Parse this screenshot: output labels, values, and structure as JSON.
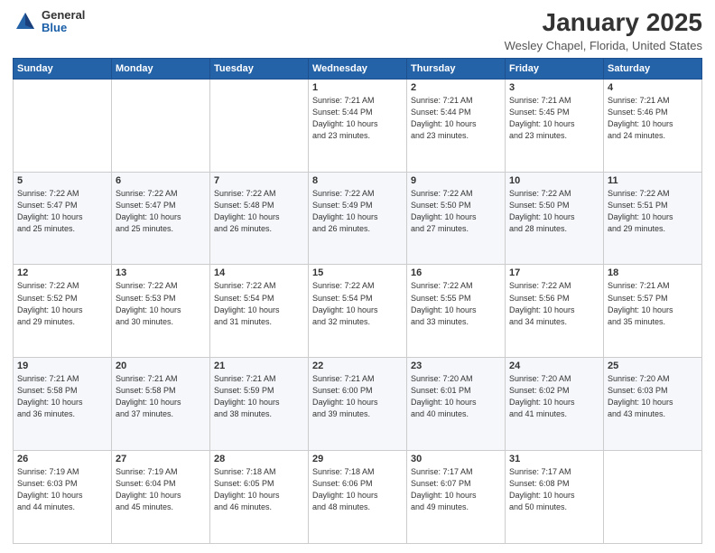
{
  "logo": {
    "general": "General",
    "blue": "Blue"
  },
  "title": "January 2025",
  "location": "Wesley Chapel, Florida, United States",
  "days_header": [
    "Sunday",
    "Monday",
    "Tuesday",
    "Wednesday",
    "Thursday",
    "Friday",
    "Saturday"
  ],
  "weeks": [
    [
      {
        "day": "",
        "info": ""
      },
      {
        "day": "",
        "info": ""
      },
      {
        "day": "",
        "info": ""
      },
      {
        "day": "1",
        "info": "Sunrise: 7:21 AM\nSunset: 5:44 PM\nDaylight: 10 hours\nand 23 minutes."
      },
      {
        "day": "2",
        "info": "Sunrise: 7:21 AM\nSunset: 5:44 PM\nDaylight: 10 hours\nand 23 minutes."
      },
      {
        "day": "3",
        "info": "Sunrise: 7:21 AM\nSunset: 5:45 PM\nDaylight: 10 hours\nand 23 minutes."
      },
      {
        "day": "4",
        "info": "Sunrise: 7:21 AM\nSunset: 5:46 PM\nDaylight: 10 hours\nand 24 minutes."
      }
    ],
    [
      {
        "day": "5",
        "info": "Sunrise: 7:22 AM\nSunset: 5:47 PM\nDaylight: 10 hours\nand 25 minutes."
      },
      {
        "day": "6",
        "info": "Sunrise: 7:22 AM\nSunset: 5:47 PM\nDaylight: 10 hours\nand 25 minutes."
      },
      {
        "day": "7",
        "info": "Sunrise: 7:22 AM\nSunset: 5:48 PM\nDaylight: 10 hours\nand 26 minutes."
      },
      {
        "day": "8",
        "info": "Sunrise: 7:22 AM\nSunset: 5:49 PM\nDaylight: 10 hours\nand 26 minutes."
      },
      {
        "day": "9",
        "info": "Sunrise: 7:22 AM\nSunset: 5:50 PM\nDaylight: 10 hours\nand 27 minutes."
      },
      {
        "day": "10",
        "info": "Sunrise: 7:22 AM\nSunset: 5:50 PM\nDaylight: 10 hours\nand 28 minutes."
      },
      {
        "day": "11",
        "info": "Sunrise: 7:22 AM\nSunset: 5:51 PM\nDaylight: 10 hours\nand 29 minutes."
      }
    ],
    [
      {
        "day": "12",
        "info": "Sunrise: 7:22 AM\nSunset: 5:52 PM\nDaylight: 10 hours\nand 29 minutes."
      },
      {
        "day": "13",
        "info": "Sunrise: 7:22 AM\nSunset: 5:53 PM\nDaylight: 10 hours\nand 30 minutes."
      },
      {
        "day": "14",
        "info": "Sunrise: 7:22 AM\nSunset: 5:54 PM\nDaylight: 10 hours\nand 31 minutes."
      },
      {
        "day": "15",
        "info": "Sunrise: 7:22 AM\nSunset: 5:54 PM\nDaylight: 10 hours\nand 32 minutes."
      },
      {
        "day": "16",
        "info": "Sunrise: 7:22 AM\nSunset: 5:55 PM\nDaylight: 10 hours\nand 33 minutes."
      },
      {
        "day": "17",
        "info": "Sunrise: 7:22 AM\nSunset: 5:56 PM\nDaylight: 10 hours\nand 34 minutes."
      },
      {
        "day": "18",
        "info": "Sunrise: 7:21 AM\nSunset: 5:57 PM\nDaylight: 10 hours\nand 35 minutes."
      }
    ],
    [
      {
        "day": "19",
        "info": "Sunrise: 7:21 AM\nSunset: 5:58 PM\nDaylight: 10 hours\nand 36 minutes."
      },
      {
        "day": "20",
        "info": "Sunrise: 7:21 AM\nSunset: 5:58 PM\nDaylight: 10 hours\nand 37 minutes."
      },
      {
        "day": "21",
        "info": "Sunrise: 7:21 AM\nSunset: 5:59 PM\nDaylight: 10 hours\nand 38 minutes."
      },
      {
        "day": "22",
        "info": "Sunrise: 7:21 AM\nSunset: 6:00 PM\nDaylight: 10 hours\nand 39 minutes."
      },
      {
        "day": "23",
        "info": "Sunrise: 7:20 AM\nSunset: 6:01 PM\nDaylight: 10 hours\nand 40 minutes."
      },
      {
        "day": "24",
        "info": "Sunrise: 7:20 AM\nSunset: 6:02 PM\nDaylight: 10 hours\nand 41 minutes."
      },
      {
        "day": "25",
        "info": "Sunrise: 7:20 AM\nSunset: 6:03 PM\nDaylight: 10 hours\nand 43 minutes."
      }
    ],
    [
      {
        "day": "26",
        "info": "Sunrise: 7:19 AM\nSunset: 6:03 PM\nDaylight: 10 hours\nand 44 minutes."
      },
      {
        "day": "27",
        "info": "Sunrise: 7:19 AM\nSunset: 6:04 PM\nDaylight: 10 hours\nand 45 minutes."
      },
      {
        "day": "28",
        "info": "Sunrise: 7:18 AM\nSunset: 6:05 PM\nDaylight: 10 hours\nand 46 minutes."
      },
      {
        "day": "29",
        "info": "Sunrise: 7:18 AM\nSunset: 6:06 PM\nDaylight: 10 hours\nand 48 minutes."
      },
      {
        "day": "30",
        "info": "Sunrise: 7:17 AM\nSunset: 6:07 PM\nDaylight: 10 hours\nand 49 minutes."
      },
      {
        "day": "31",
        "info": "Sunrise: 7:17 AM\nSunset: 6:08 PM\nDaylight: 10 hours\nand 50 minutes."
      },
      {
        "day": "",
        "info": ""
      }
    ]
  ]
}
